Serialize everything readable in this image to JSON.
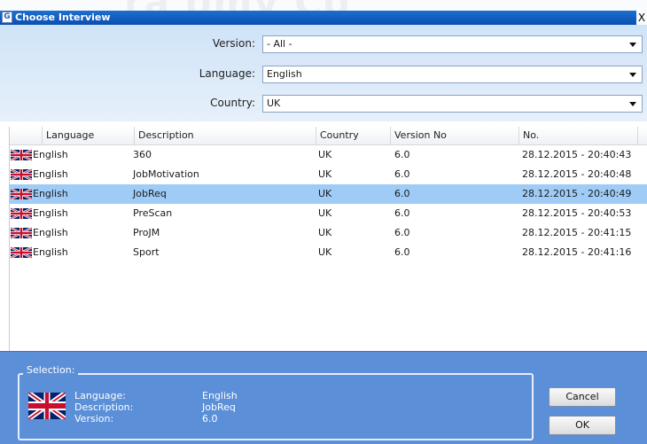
{
  "window": {
    "title": "Choose Interview",
    "close_glyph": "X",
    "app_icon_glyph": "G"
  },
  "watermark": {
    "text": "ra omy Co"
  },
  "filters": {
    "version": {
      "label": "Version:",
      "value": "- All -"
    },
    "language": {
      "label": "Language:",
      "value": "English"
    },
    "country": {
      "label": "Country:",
      "value": "UK"
    }
  },
  "table": {
    "columns": [
      "Language",
      "Description",
      "Country",
      "Version No",
      "No."
    ],
    "rows": [
      {
        "flag": "uk-flag-icon",
        "language": "English",
        "description": "360",
        "country": "UK",
        "version": "6.0",
        "no": "28.12.2015 - 20:40:43",
        "selected": false
      },
      {
        "flag": "uk-flag-icon",
        "language": "English",
        "description": "JobMotivation",
        "country": "UK",
        "version": "6.0",
        "no": "28.12.2015 - 20:40:48",
        "selected": false
      },
      {
        "flag": "uk-flag-icon",
        "language": "English",
        "description": "JobReq",
        "country": "UK",
        "version": "6.0",
        "no": "28.12.2015 - 20:40:49",
        "selected": true
      },
      {
        "flag": "uk-flag-icon",
        "language": "English",
        "description": "PreScan",
        "country": "UK",
        "version": "6.0",
        "no": "28.12.2015 - 20:40:53",
        "selected": false
      },
      {
        "flag": "uk-flag-icon",
        "language": "English",
        "description": "ProJM",
        "country": "UK",
        "version": "6.0",
        "no": "28.12.2015 - 20:41:15",
        "selected": false
      },
      {
        "flag": "uk-flag-icon",
        "language": "English",
        "description": "Sport",
        "country": "UK",
        "version": "6.0",
        "no": "28.12.2015 - 20:41:16",
        "selected": false
      }
    ]
  },
  "selection": {
    "title": "Selection:",
    "flag": "uk-flag-icon",
    "language_label": "Language:",
    "language_value": "English",
    "description_label": "Description:",
    "description_value": "JobReq",
    "version_label": "Version:",
    "version_value": "6.0"
  },
  "buttons": {
    "cancel": "Cancel",
    "ok": "OK"
  },
  "colors": {
    "title_bar": "#0a5cc8",
    "selected_row": "#9fccf6",
    "bottom_panel": "#5b8fd8",
    "filter_panel": "#d6e6f7"
  }
}
